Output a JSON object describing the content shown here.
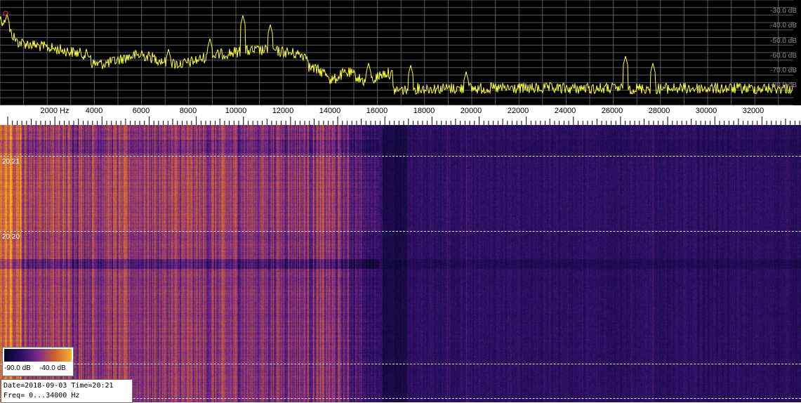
{
  "spectrum": {
    "db_labels": [
      "-30.0 dB",
      "-40.0 dB",
      "-50.0 dB",
      "-60.0 dB",
      "-70.0 dB",
      "-80.0 dB"
    ],
    "trace_color": "#ffff33",
    "grid_color": "#5a5a5a",
    "peak_marker_color": "#ff3333"
  },
  "freq_axis": {
    "labels": [
      "2000 Hz",
      "4000",
      "6000",
      "8000",
      "10000",
      "12000",
      "14000",
      "16000",
      "18000",
      "20000",
      "22000",
      "24000",
      "26000",
      "28000",
      "30000",
      "32000"
    ]
  },
  "waterfall": {
    "time_markers": [
      "20:21",
      "20:20"
    ],
    "colormap": [
      "#06062a",
      "#2b0f63",
      "#7a2a8a",
      "#cf6032",
      "#f7b22d"
    ]
  },
  "legend": {
    "min_label": "-90.0 dB",
    "max_label": "-40.0 dB"
  },
  "info": {
    "line1": "Date=2018-09-03 Time=20:21",
    "line2": "Freq= 0...34000 Hz"
  }
}
